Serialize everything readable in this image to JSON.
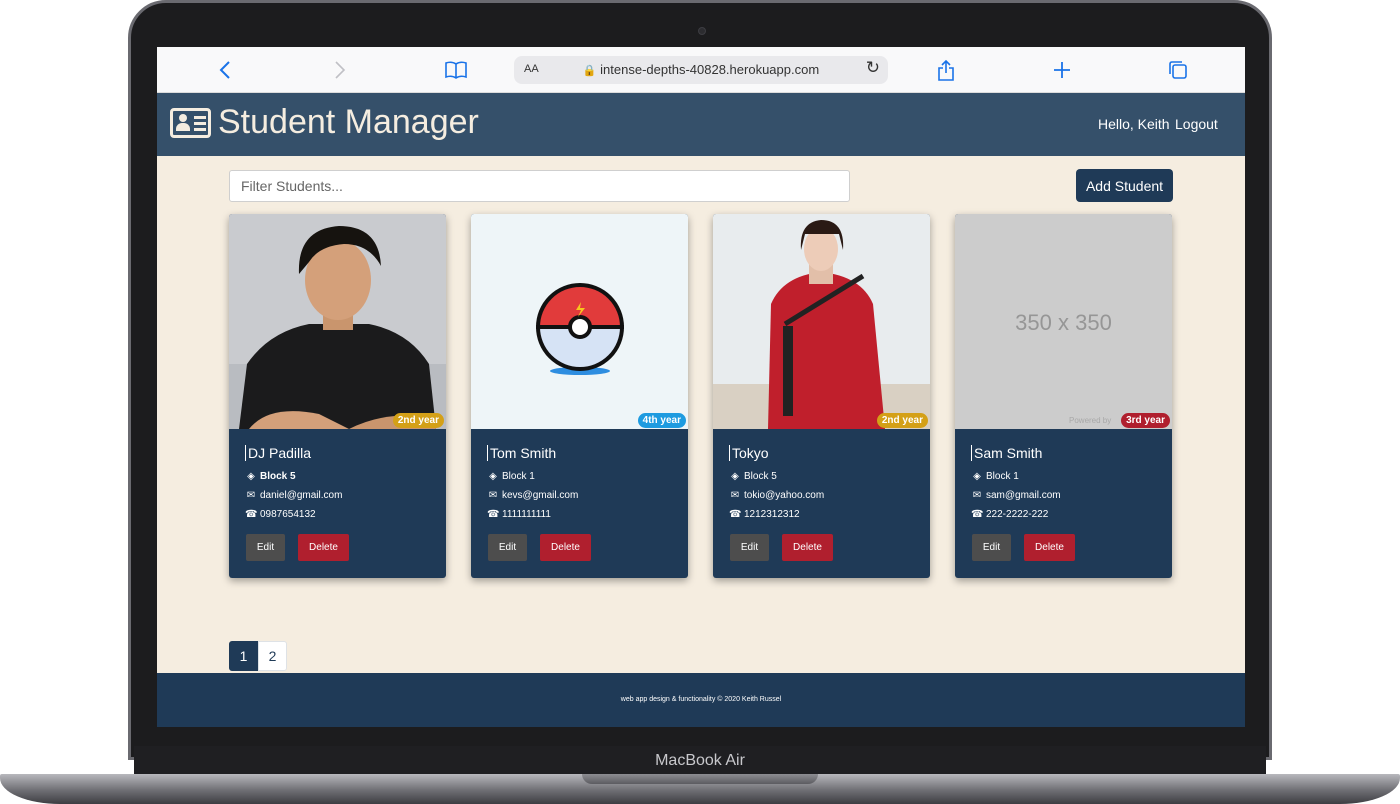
{
  "device": {
    "name": "MacBook Air"
  },
  "browser": {
    "url": "intense-depths-40828.herokuapp.com",
    "text_size_label": "AA"
  },
  "app": {
    "title": "Student Manager",
    "greeting": "Hello, Keith",
    "logout_label": "Logout",
    "filter_placeholder": "Filter Students...",
    "add_student_label": "Add Student",
    "colors": {
      "header": "#35506a",
      "card": "#1f3a57",
      "background": "#f5ede0",
      "delete": "#b01f2e",
      "edit": "#4d4d4d"
    }
  },
  "students": [
    {
      "name": "DJ Padilla",
      "block": "Block 5",
      "email": "daniel@gmail.com",
      "phone": "0987654132",
      "year": "2nd year",
      "year_color": "#d4a017",
      "edit_label": "Edit",
      "delete_label": "Delete"
    },
    {
      "name": "Tom Smith",
      "block": "Block 1",
      "email": "kevs@gmail.com",
      "phone": "1111111111",
      "year": "4th year",
      "year_color": "#1e9be0",
      "edit_label": "Edit",
      "delete_label": "Delete"
    },
    {
      "name": "Tokyo",
      "block": "Block 5",
      "email": "tokio@yahoo.com",
      "phone": "1212312312",
      "year": "2nd year",
      "year_color": "#d4a017",
      "edit_label": "Edit",
      "delete_label": "Delete"
    },
    {
      "name": "Sam Smith",
      "block": "Block 1",
      "email": "sam@gmail.com",
      "phone": "222-2222-222",
      "year": "3rd year",
      "year_color": "#b01f2e",
      "edit_label": "Edit",
      "delete_label": "Delete",
      "placeholder_text": "350 x 350",
      "powered_by": "Powered by"
    }
  ],
  "pagination": {
    "pages": [
      "1",
      "2"
    ],
    "active": "1"
  },
  "footer": {
    "text": "web app design & functionality © 2020 Keith Russel"
  }
}
